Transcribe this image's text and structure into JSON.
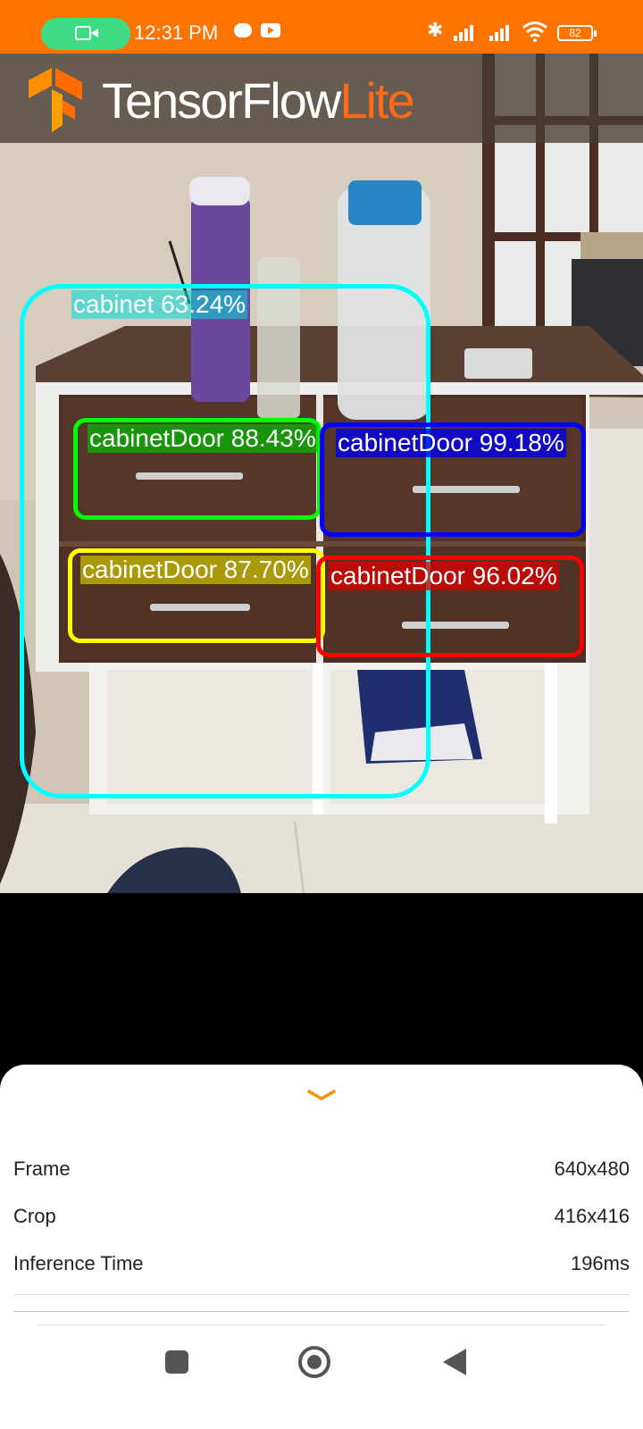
{
  "status_bar": {
    "time": "12:31 PM",
    "battery": "82",
    "icons": [
      "video-call-icon",
      "chat-bubble-icon",
      "youtube-icon",
      "bluetooth-icon",
      "signal-icon",
      "signal-icon",
      "wifi-icon",
      "battery-icon"
    ],
    "color": "#ff7300"
  },
  "header": {
    "brand_main": "TensorFlow",
    "brand_accent": "Lite",
    "accent_color": "#ff6a1a"
  },
  "detections": [
    {
      "label": "cabinet 63.24%",
      "color": "#00ffff"
    },
    {
      "label": "cabinetDoor 88.43%",
      "color": "#00ff00"
    },
    {
      "label": "cabinetDoor 99.18%",
      "color": "#0000ff"
    },
    {
      "label": "cabinetDoor 87.70%",
      "color": "#ffff00"
    },
    {
      "label": "cabinetDoor 96.02%",
      "color": "#ff0000"
    }
  ],
  "bottom_sheet": {
    "rows": [
      {
        "key": "Frame",
        "value": "640x480"
      },
      {
        "key": "Crop",
        "value": "416x416"
      },
      {
        "key": "Inference Time",
        "value": "196ms"
      }
    ]
  },
  "nav": {
    "icons": [
      "recent-apps-icon",
      "home-icon",
      "back-icon"
    ]
  }
}
